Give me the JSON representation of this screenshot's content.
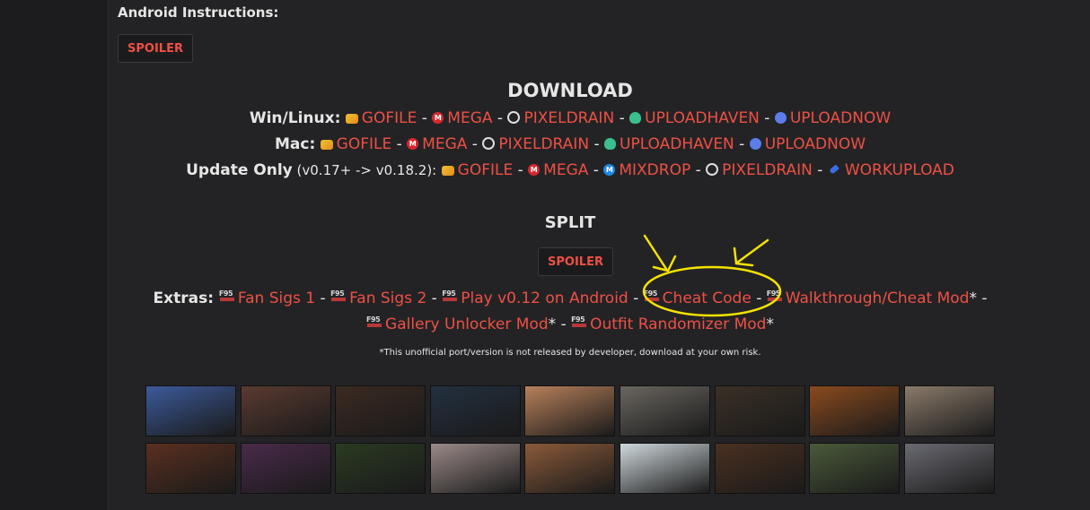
{
  "android": {
    "title": "Android Instructions:",
    "spoiler_label": "SPOILER"
  },
  "download": {
    "title": "DOWNLOAD",
    "sep": "-",
    "rows": [
      {
        "label": "Win/Linux:",
        "version": "",
        "links": [
          {
            "icon": "gofile-icon",
            "text": "GOFILE"
          },
          {
            "icon": "mega-icon",
            "text": "MEGA"
          },
          {
            "icon": "pixeldrain-icon",
            "text": "PIXELDRAIN"
          },
          {
            "icon": "uploadhaven-icon",
            "text": "UPLOADHAVEN"
          },
          {
            "icon": "uploadnow-icon",
            "text": "UPLOADNOW"
          }
        ]
      },
      {
        "label": "Mac:",
        "version": "",
        "links": [
          {
            "icon": "gofile-icon",
            "text": "GOFILE"
          },
          {
            "icon": "mega-icon",
            "text": "MEGA"
          },
          {
            "icon": "pixeldrain-icon",
            "text": "PIXELDRAIN"
          },
          {
            "icon": "uploadhaven-icon",
            "text": "UPLOADHAVEN"
          },
          {
            "icon": "uploadnow-icon",
            "text": "UPLOADNOW"
          }
        ]
      },
      {
        "label": "Update Only",
        "version": "(v0.17+ -> v0.18.2):",
        "links": [
          {
            "icon": "gofile-icon",
            "text": "GOFILE"
          },
          {
            "icon": "mega-icon",
            "text": "MEGA"
          },
          {
            "icon": "mixdrop-icon",
            "text": "MIXDROP"
          },
          {
            "icon": "pixeldrain-icon",
            "text": "PIXELDRAIN"
          },
          {
            "icon": "workupload-icon",
            "text": "WORKUPLOAD"
          }
        ]
      }
    ]
  },
  "split": {
    "title": "SPLIT",
    "spoiler_label": "SPOILER"
  },
  "extras": {
    "label": "Extras:",
    "items": [
      {
        "text": "Fan Sigs 1",
        "suffix": " - "
      },
      {
        "text": "Fan Sigs 2",
        "suffix": " - "
      },
      {
        "text": "Play v0.12 on Android",
        "suffix": " - "
      },
      {
        "text": "Cheat Code",
        "suffix": " - "
      },
      {
        "text": "Walkthrough/Cheat Mod",
        "suffix": "* -"
      },
      {
        "text": "Gallery Unlocker Mod",
        "suffix": "* - "
      },
      {
        "text": "Outfit Randomizer Mod",
        "suffix": "*"
      }
    ],
    "disclaimer": "*This unofficial port/version is not released by developer, download at your own risk."
  },
  "gallery": {
    "row1_colors": [
      "#3c5a9a",
      "#5a3a30",
      "#3b2a22",
      "#23303f",
      "#b8805a",
      "#6a6660",
      "#3a3026",
      "#8a4a1e",
      "#8a7a6a"
    ],
    "row2_colors": [
      "#5a3020",
      "#4a2a4a",
      "#2a3a22",
      "#9a8a88",
      "#8a5a3a",
      "#cfd8dc",
      "#4a3020",
      "#4a5a3a",
      "#6a6a72"
    ]
  },
  "annotation": {
    "color": "#f5e200"
  }
}
